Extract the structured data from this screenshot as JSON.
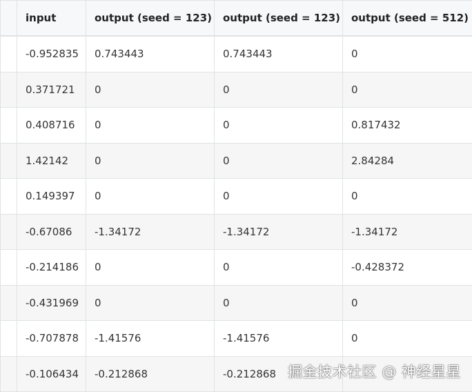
{
  "table": {
    "headers": [
      "",
      "input",
      "output (seed = 123)",
      "output (seed = 123)",
      "output (seed = 512)"
    ],
    "rows": [
      [
        "",
        "-0.952835",
        "0.743443",
        "0.743443",
        "0"
      ],
      [
        "",
        "0.371721",
        "0",
        "0",
        "0"
      ],
      [
        "",
        "0.408716",
        "0",
        "0",
        "0.817432"
      ],
      [
        "",
        "1.42142",
        "0",
        "0",
        "2.84284"
      ],
      [
        "",
        "0.149397",
        "0",
        "0",
        "0"
      ],
      [
        "",
        "-0.67086",
        "-1.34172",
        "-1.34172",
        "-1.34172"
      ],
      [
        "",
        "-0.214186",
        "0",
        "0",
        "-0.428372"
      ],
      [
        "",
        "-0.431969",
        "0",
        "0",
        "0"
      ],
      [
        "",
        "-0.707878",
        "-1.41576",
        "-1.41576",
        "0"
      ],
      [
        "",
        "-0.106434",
        "-0.212868",
        "-0.212868",
        ""
      ]
    ]
  },
  "watermark": "掘金技术社区 @ 神经星星"
}
